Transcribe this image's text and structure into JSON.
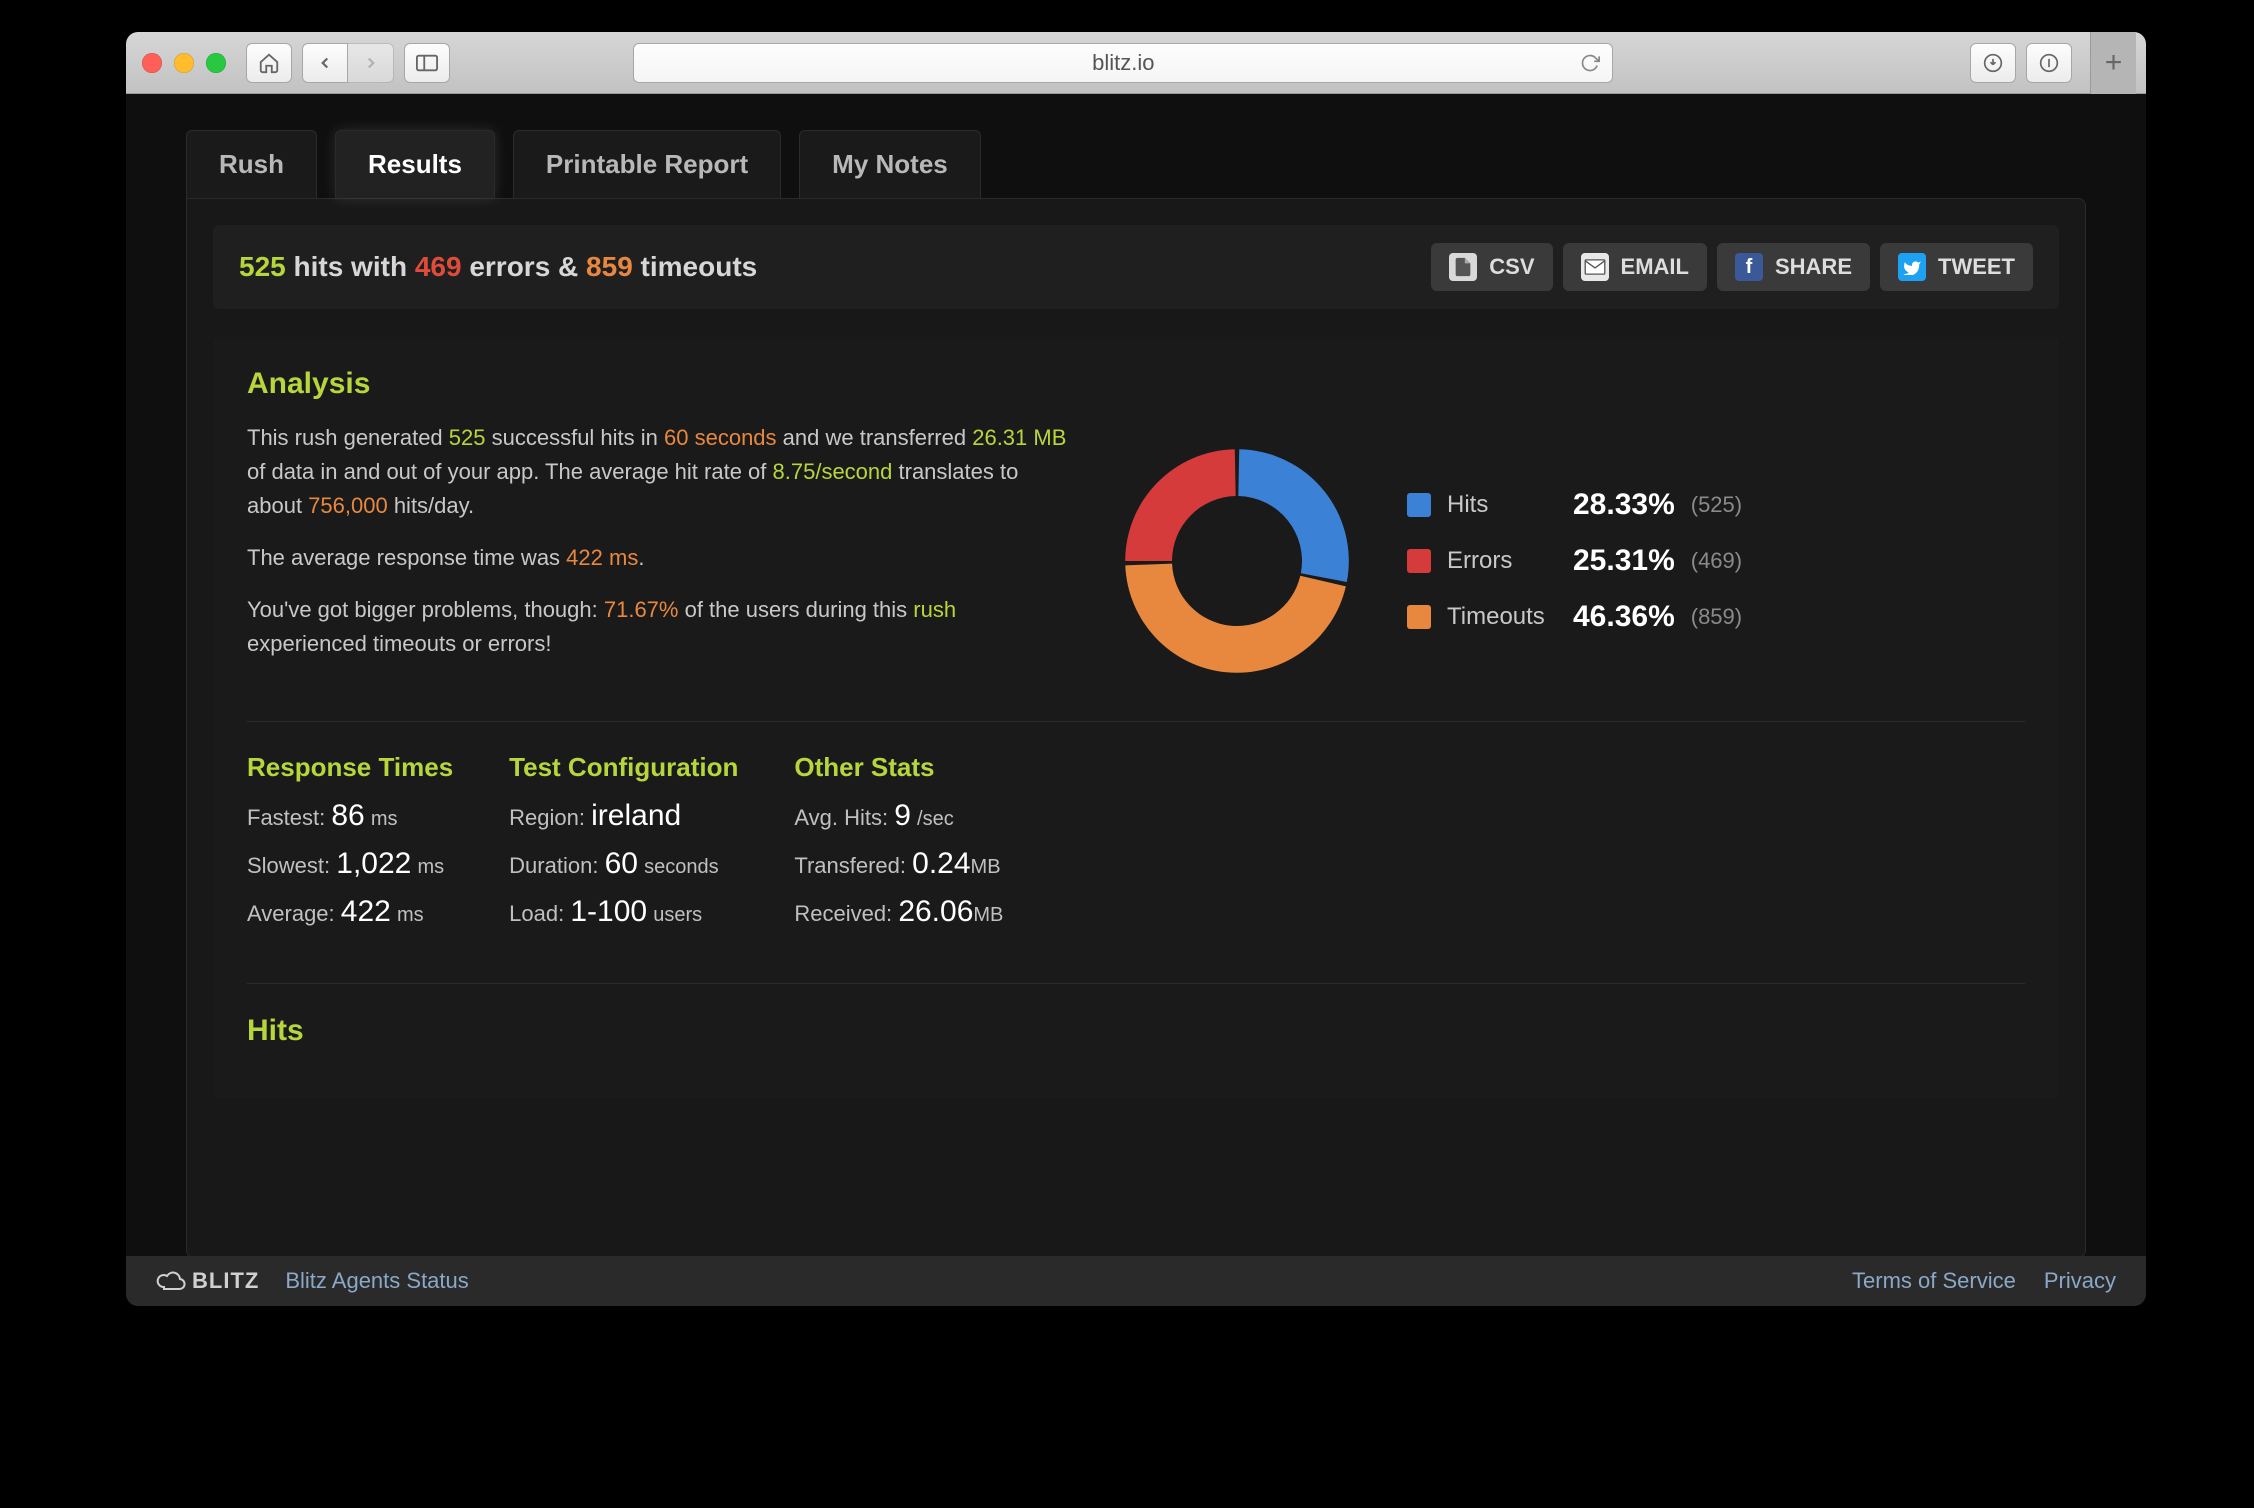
{
  "browser": {
    "url": "blitz.io"
  },
  "tabs": [
    "Rush",
    "Results",
    "Printable Report",
    "My Notes"
  ],
  "active_tab_index": 1,
  "summary": {
    "hits": "525",
    "hits_word": "hits with",
    "errors": "469",
    "errors_word": "errors &",
    "timeouts": "859",
    "timeouts_word": "timeouts"
  },
  "actions": {
    "csv": "CSV",
    "email": "EMAIL",
    "share": "SHARE",
    "tweet": "TWEET"
  },
  "analysis": {
    "heading": "Analysis",
    "p1a": "This rush generated ",
    "p1_hits": "525",
    "p1b": " successful hits in ",
    "p1_secs": "60 seconds",
    "p1c": " and we transferred ",
    "p1_mb": "26.31 MB",
    "p1d": " of data in and out of your app. The average hit rate of ",
    "p1_rate": "8.75/second",
    "p1e": " translates to about ",
    "p1_perday": "756,000",
    "p1f": " hits/day.",
    "p2a": "The average response time was ",
    "p2_ms": "422 ms",
    "p2b": ".",
    "p3a": "You've got bigger problems, though: ",
    "p3_pct": "71.67%",
    "p3b": " of the users during this ",
    "p3_rush": "rush",
    "p3c": " experienced timeouts or errors!"
  },
  "chart_data": {
    "type": "pie",
    "title": "",
    "series": [
      {
        "name": "Hits",
        "value": 525,
        "percent": 28.33,
        "color": "#3b82d6"
      },
      {
        "name": "Errors",
        "value": 469,
        "percent": 25.31,
        "color": "#d63b3b"
      },
      {
        "name": "Timeouts",
        "value": 859,
        "percent": 46.36,
        "color": "#e8883f"
      }
    ]
  },
  "legend": {
    "hits_label": "Hits",
    "hits_pct": "28.33%",
    "hits_cnt": "(525)",
    "errors_label": "Errors",
    "errors_pct": "25.31%",
    "errors_cnt": "(469)",
    "timeouts_label": "Timeouts",
    "timeouts_pct": "46.36%",
    "timeouts_cnt": "(859)"
  },
  "stats": {
    "response_times": {
      "heading": "Response Times",
      "fastest_label": "Fastest:",
      "fastest_val": "86",
      "fastest_unit": "ms",
      "slowest_label": "Slowest:",
      "slowest_val": "1,022",
      "slowest_unit": "ms",
      "average_label": "Average:",
      "average_val": "422",
      "average_unit": "ms"
    },
    "config": {
      "heading": "Test Configuration",
      "region_label": "Region:",
      "region_val": "ireland",
      "duration_label": "Duration:",
      "duration_val": "60",
      "duration_unit": "seconds",
      "load_label": "Load:",
      "load_val": "1-100",
      "load_unit": "users"
    },
    "other": {
      "heading": "Other Stats",
      "avghits_label": "Avg. Hits:",
      "avghits_val": "9",
      "avghits_unit": "/sec",
      "transfered_label": "Transfered:",
      "transfered_val": "0.24",
      "transfered_unit": "MB",
      "received_label": "Received:",
      "received_val": "26.06",
      "received_unit": "MB"
    }
  },
  "next_heading": "Hits",
  "footer": {
    "brand": "BLITZ",
    "status": "Blitz Agents Status",
    "tos": "Terms of Service",
    "privacy": "Privacy"
  }
}
